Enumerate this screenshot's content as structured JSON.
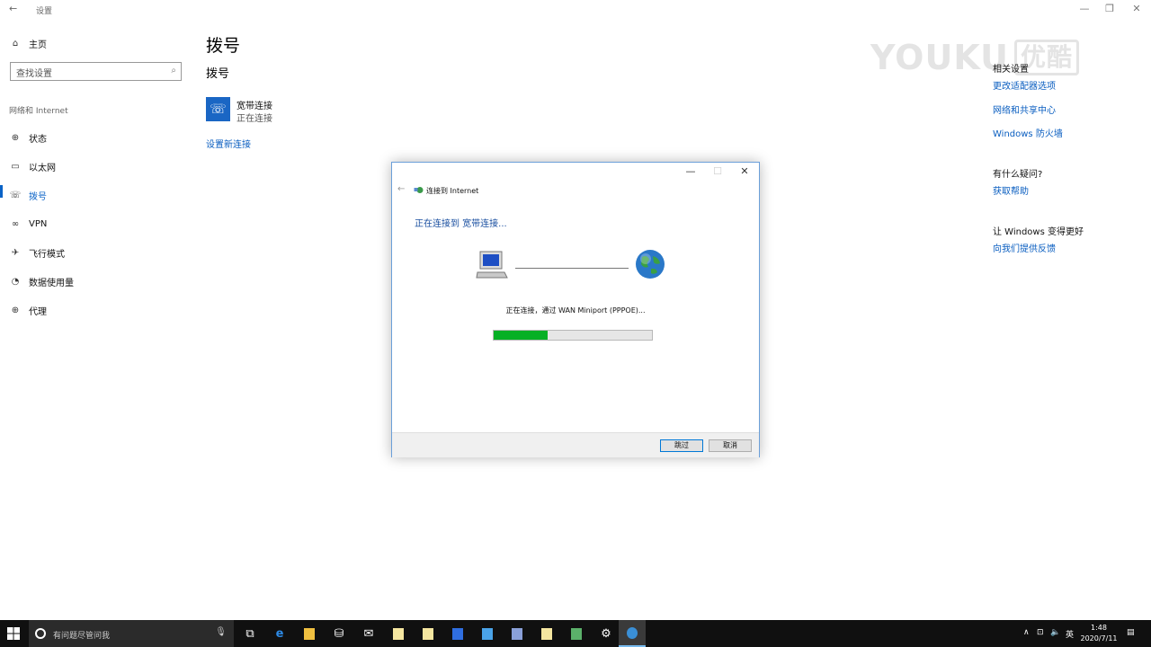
{
  "window": {
    "title": "设置",
    "back": "←",
    "minimize": "—",
    "restore": "❐",
    "close": "✕"
  },
  "sidebar": {
    "home": "主页",
    "search_placeholder": "查找设置",
    "section": "网络和 Internet",
    "items": [
      {
        "label": "状态",
        "icon": "globe-icon",
        "glyph": "⊕"
      },
      {
        "label": "以太网",
        "icon": "ethernet-icon",
        "glyph": "▭"
      },
      {
        "label": "拨号",
        "icon": "dialup-icon",
        "glyph": "☏"
      },
      {
        "label": "VPN",
        "icon": "vpn-icon",
        "glyph": "∞"
      },
      {
        "label": "飞行模式",
        "icon": "airplane-icon",
        "glyph": "✈"
      },
      {
        "label": "数据使用量",
        "icon": "data-usage-icon",
        "glyph": "◔"
      },
      {
        "label": "代理",
        "icon": "proxy-icon",
        "glyph": "⊕"
      }
    ],
    "active_index": 2
  },
  "main": {
    "title": "拨号",
    "subtitle": "拨号",
    "connection": {
      "name": "宽带连接",
      "status": "正在连接"
    },
    "setup_link": "设置新连接"
  },
  "related": {
    "heading": "相关设置",
    "links": [
      "更改适配器选项",
      "网络和共享中心",
      "Windows 防火墙"
    ],
    "question_heading": "有什么疑问?",
    "help_link": "获取帮助",
    "feedback_heading": "让 Windows 变得更好",
    "feedback_link": "向我们提供反馈"
  },
  "watermark": {
    "text": "YOUKU",
    "cn": "优酷"
  },
  "dialog": {
    "nav_title": "连接到 Internet",
    "heading": "正在连接到 宽带连接...",
    "status": "正在连接，通过 WAN Miniport (PPPOE)...",
    "progress": 0.34,
    "skip_button": "跳过",
    "cancel_button": "取消",
    "colors": {
      "progress": "#06b025",
      "heading": "#1a4fa0"
    }
  },
  "taskbar": {
    "search_placeholder": "有问题尽管问我",
    "tray_ime": "英",
    "time": "1:48",
    "date": "2020/7/11"
  },
  "colors": {
    "accent": "#0a63c7",
    "link": "#0a5ec0",
    "taskbar": "#101010"
  }
}
